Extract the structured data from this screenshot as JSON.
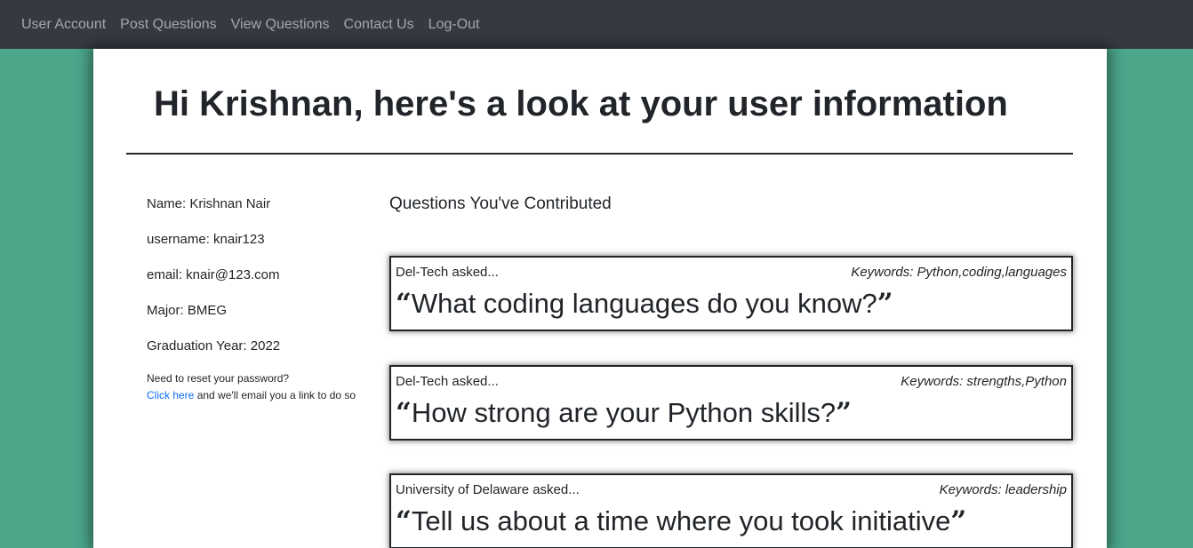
{
  "nav": {
    "items": [
      "User Account",
      "Post Questions",
      "View Questions",
      "Contact Us",
      "Log-Out"
    ]
  },
  "page": {
    "title": "Hi Krishnan, here's a look at your user information"
  },
  "user": {
    "name_line": "Name: Krishnan Nair",
    "username_line": "username: knair123",
    "email_line": "email: knair@123.com",
    "major_line": "Major: BMEG",
    "grad_line": "Graduation Year: 2022",
    "reset_prompt": "Need to reset your password?",
    "reset_link": "Click here",
    "reset_suffix": " and we'll email you a link to do so"
  },
  "contributions": {
    "title": "Questions You've Contributed",
    "open_quote": "“",
    "close_quote": "”",
    "questions": [
      {
        "asker": "Del-Tech asked...",
        "keywords": "Keywords: Python,coding,languages",
        "text": "What coding languages do you know?"
      },
      {
        "asker": "Del-Tech asked...",
        "keywords": "Keywords: strengths,Python",
        "text": "How strong are your Python skills?"
      },
      {
        "asker": "University of Delaware asked...",
        "keywords": "Keywords: leadership",
        "text": "Tell us about a time where you took initiative"
      }
    ]
  }
}
